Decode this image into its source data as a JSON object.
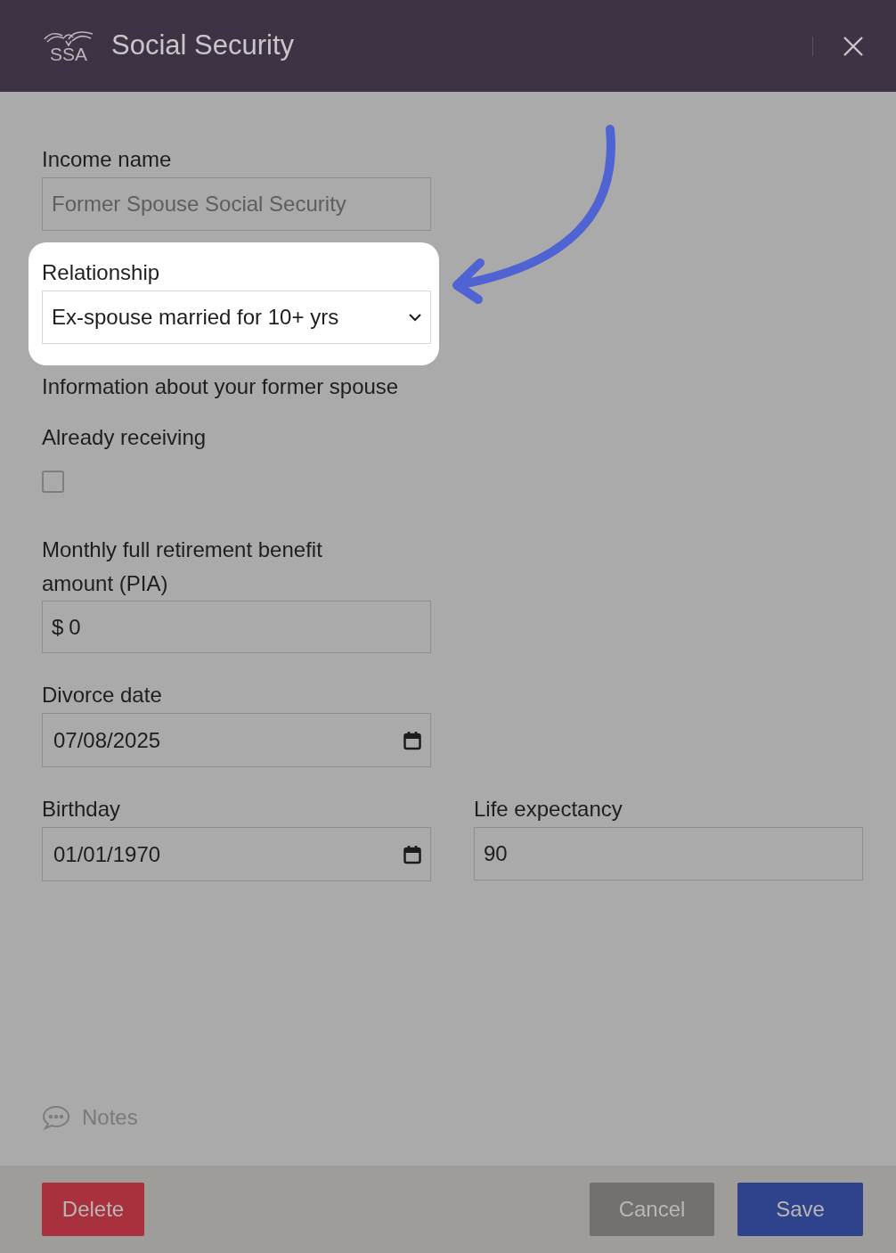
{
  "header": {
    "logo_text": "SSA",
    "title": "Social Security"
  },
  "fields": [
    {
      "kind": "text",
      "label": "Income name",
      "placeholder": "Former Spouse Social Security"
    },
    {
      "kind": "select",
      "label": "Relationship",
      "value": "Ex-spouse married for 10+ yrs",
      "highlighted": true
    },
    {
      "kind": "heading",
      "label": "Information about your former spouse"
    },
    {
      "kind": "checkbox",
      "label": "Already receiving",
      "checked": false
    },
    {
      "kind": "currency",
      "label": "Monthly full retirement benefit amount (PIA)",
      "prefix": "$",
      "value": "0"
    },
    {
      "kind": "date",
      "label": "Divorce date",
      "value": "07/08/2025"
    },
    {
      "kind": "pair",
      "items": [
        {
          "kind": "date",
          "label": "Birthday",
          "value": "01/01/1970"
        },
        {
          "kind": "text",
          "label": "Life expectancy",
          "value": "90"
        }
      ]
    }
  ],
  "notes": {
    "label": "Notes"
  },
  "buttons": [
    {
      "kind": "delete",
      "label": "Delete"
    },
    {
      "kind": "cancel",
      "label": "Cancel"
    },
    {
      "kind": "save",
      "label": "Save"
    }
  ]
}
